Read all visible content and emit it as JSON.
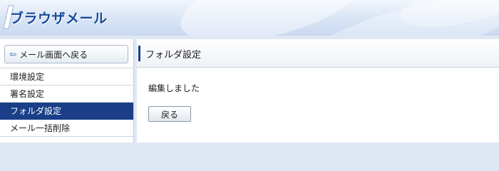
{
  "header": {
    "app_title": "ブラウザメール"
  },
  "sidebar": {
    "back_button": {
      "icon": "left-arrow-icon",
      "label": "メール画面へ戻る"
    },
    "items": [
      {
        "label": "環境設定",
        "active": false
      },
      {
        "label": "署名設定",
        "active": false
      },
      {
        "label": "フォルダ設定",
        "active": true
      },
      {
        "label": "メール一括削除",
        "active": false
      }
    ]
  },
  "main": {
    "title": "フォルダ設定",
    "message": "編集しました",
    "button_label": "戻る"
  },
  "colors": {
    "brand": "#17489a",
    "active_item": "#1a3f88",
    "header_background": "#dce7f6"
  }
}
